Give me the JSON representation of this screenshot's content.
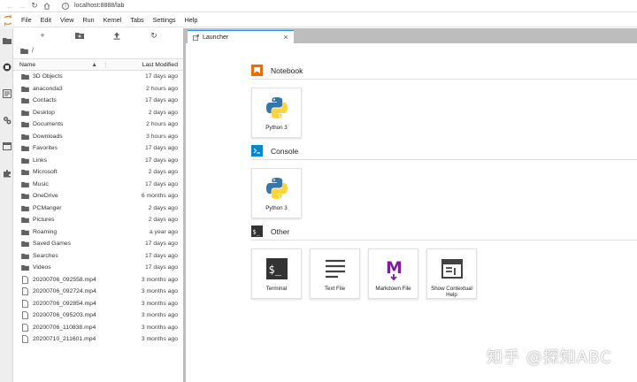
{
  "browser": {
    "url": "localhost:8888/lab"
  },
  "menubar": {
    "items": [
      "File",
      "Edit",
      "View",
      "Run",
      "Kernel",
      "Tabs",
      "Settings",
      "Help"
    ]
  },
  "filebrowser": {
    "path": "/",
    "col_name": "Name",
    "col_modified": "Last Modified",
    "rows": [
      {
        "name": "3D Objects",
        "modified": "17 days ago",
        "type": "folder"
      },
      {
        "name": "anaconda3",
        "modified": "2 hours ago",
        "type": "folder"
      },
      {
        "name": "Contacts",
        "modified": "17 days ago",
        "type": "folder"
      },
      {
        "name": "Desktop",
        "modified": "2 days ago",
        "type": "folder"
      },
      {
        "name": "Documents",
        "modified": "2 hours ago",
        "type": "folder"
      },
      {
        "name": "Downloads",
        "modified": "3 hours ago",
        "type": "folder"
      },
      {
        "name": "Favorites",
        "modified": "17 days ago",
        "type": "folder"
      },
      {
        "name": "Links",
        "modified": "17 days ago",
        "type": "folder"
      },
      {
        "name": "Microsoft",
        "modified": "2 days ago",
        "type": "folder"
      },
      {
        "name": "Music",
        "modified": "17 days ago",
        "type": "folder"
      },
      {
        "name": "OneDrive",
        "modified": "6 months ago",
        "type": "folder"
      },
      {
        "name": "PCManger",
        "modified": "2 days ago",
        "type": "folder"
      },
      {
        "name": "Pictures",
        "modified": "2 days ago",
        "type": "folder"
      },
      {
        "name": "Roaming",
        "modified": "a year ago",
        "type": "folder"
      },
      {
        "name": "Saved Games",
        "modified": "17 days ago",
        "type": "folder"
      },
      {
        "name": "Searches",
        "modified": "17 days ago",
        "type": "folder"
      },
      {
        "name": "Videos",
        "modified": "17 days ago",
        "type": "folder"
      },
      {
        "name": "20200706_092558.mp4",
        "modified": "3 months ago",
        "type": "file"
      },
      {
        "name": "20200706_092724.mp4",
        "modified": "3 months ago",
        "type": "file"
      },
      {
        "name": "20200706_092854.mp4",
        "modified": "3 months ago",
        "type": "file"
      },
      {
        "name": "20200706_095203.mp4",
        "modified": "3 months ago",
        "type": "file"
      },
      {
        "name": "20200706_110838.mp4",
        "modified": "3 months ago",
        "type": "file"
      },
      {
        "name": "20200710_211601.mp4",
        "modified": "3 months ago",
        "type": "file"
      }
    ]
  },
  "tab": {
    "label": "Launcher",
    "close": "×"
  },
  "launcher": {
    "notebook": {
      "heading": "Notebook",
      "cards": [
        {
          "label": "Python 3"
        }
      ]
    },
    "console": {
      "heading": "Console",
      "cards": [
        {
          "label": "Python 3"
        }
      ]
    },
    "other": {
      "heading": "Other",
      "cards": [
        {
          "label": "Terminal",
          "icon": "terminal-icon"
        },
        {
          "label": "Text File",
          "icon": "text-file-icon"
        },
        {
          "label": "Markdown File",
          "icon": "markdown-icon"
        },
        {
          "label": "Show Contextual Help",
          "icon": "contextual-help-icon"
        }
      ]
    }
  },
  "watermark": "知乎 @探知ABC",
  "colors": {
    "accent": "#2196f3",
    "notebook_orange": "#ef6c00",
    "console_blue": "#0288d1",
    "markdown_purple": "#7b1fa2",
    "folder": "#616161"
  }
}
